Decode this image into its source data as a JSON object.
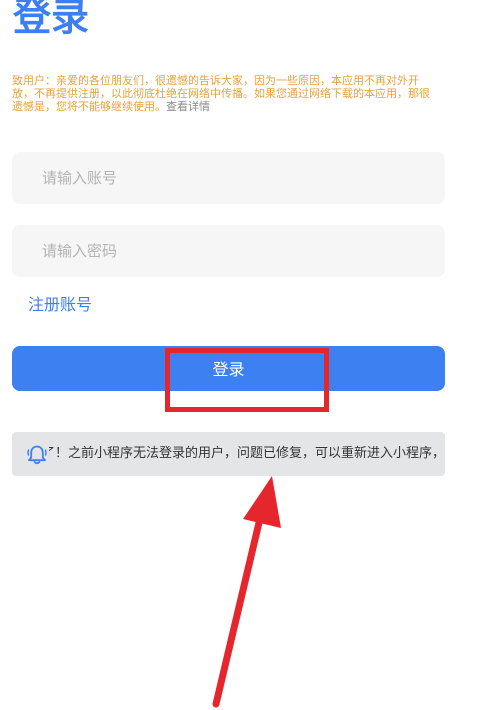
{
  "page": {
    "title": "登录"
  },
  "notice": {
    "text": "致用户：亲爱的各位朋友们，很遗憾的告诉大家，因为一些原因，本应用不再对外开放，不再提供注册，以此彻底杜绝在网络中传播。如果您通过网络下载的本应用，那很遗憾是，您将不能够继续使用。",
    "link": "查看详情"
  },
  "form": {
    "account_placeholder": "请输入账号",
    "password_placeholder": "请输入密码",
    "register_label": "注册账号",
    "login_label": "登录"
  },
  "announcement": {
    "text": "了！之前小程序无法登录的用户，问题已修复，可以重新进入小程序，绑定"
  },
  "colors": {
    "accent": "#3d80f2",
    "notice": "#e6a23c",
    "annotation": "#e5262c"
  }
}
